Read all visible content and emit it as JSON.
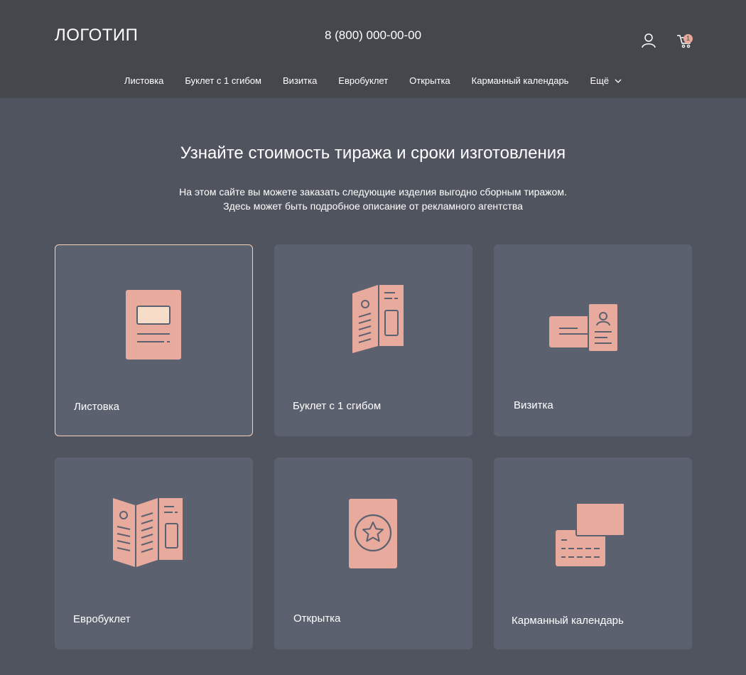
{
  "header": {
    "logo": "ЛОГОТИП",
    "phone": "8 (800) 000-00-00",
    "user_icon": "user-icon",
    "cart_icon": "cart-icon",
    "cart_count": "1"
  },
  "nav": {
    "items": [
      "Листовка",
      "Буклет с 1 сгибом",
      "Визитка",
      "Евробуклет",
      "Открытка",
      "Карманный календарь"
    ],
    "more_label": "Ещё"
  },
  "hero": {
    "title": "Узнайте стоимость тиража и сроки изготовления",
    "subtitle_line1": "На этом сайте вы можете заказать следующие изделия выгодно сборным тиражом.",
    "subtitle_line2": "Здесь может быть подробное описание от рекламного агентства"
  },
  "products": [
    {
      "label": "Листовка",
      "icon": "leaflet-icon",
      "selected": true
    },
    {
      "label": "Буклет с 1 сгибом",
      "icon": "booklet-icon",
      "selected": false
    },
    {
      "label": "Визитка",
      "icon": "business-card-icon",
      "selected": false
    },
    {
      "label": "Евробуклет",
      "icon": "eurobooklet-icon",
      "selected": false
    },
    {
      "label": "Открытка",
      "icon": "postcard-icon",
      "selected": false
    },
    {
      "label": "Карманный календарь",
      "icon": "pocket-calendar-icon",
      "selected": false
    }
  ],
  "colors": {
    "header_bg": "#45474d",
    "page_bg": "#50545f",
    "card_bg": "#5c6170",
    "accent": "#e8aa9c",
    "selected_border": "#f3d1b8"
  }
}
